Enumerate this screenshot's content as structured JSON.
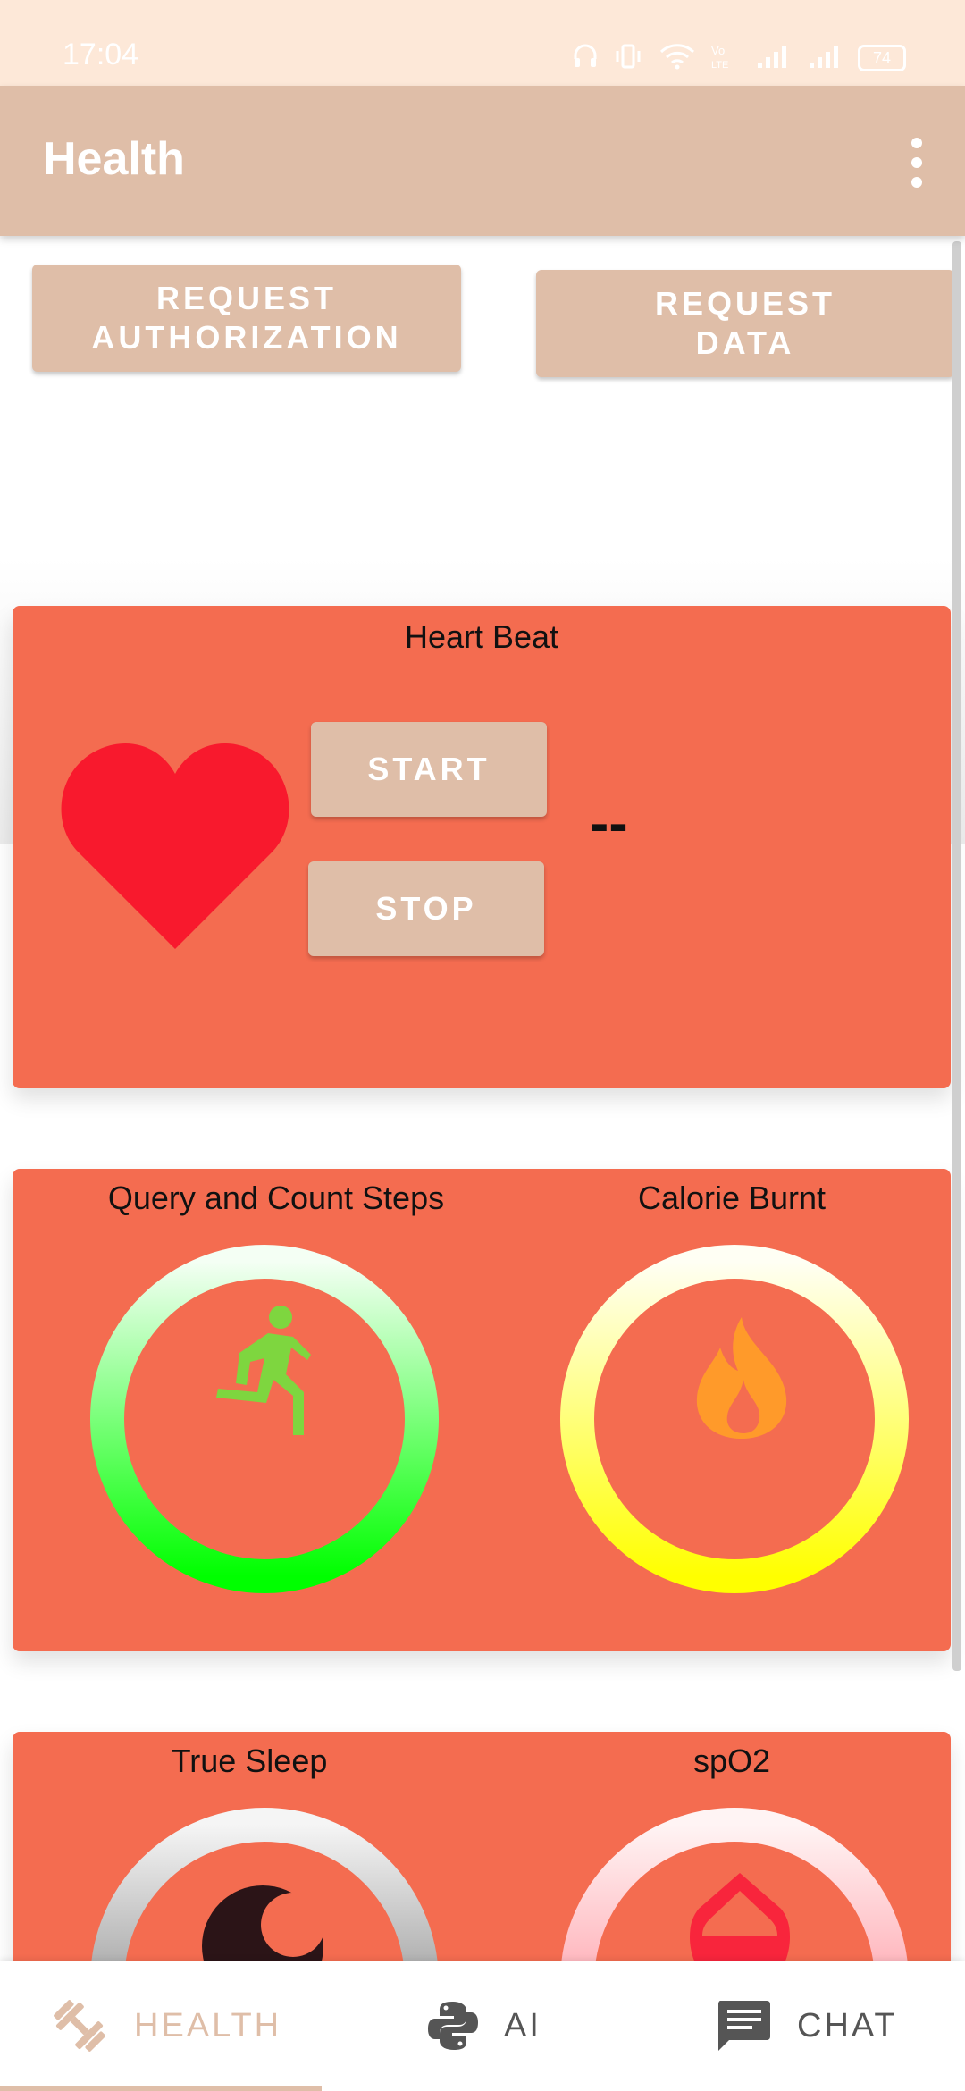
{
  "status_bar": {
    "time": "17:04",
    "battery": "74"
  },
  "app_bar": {
    "title": "Health"
  },
  "actions": {
    "request_authorization": "REQUEST\nAUTHORIZATION",
    "request_data": "REQUEST\nDATA"
  },
  "heart_card": {
    "title": "Heart Beat",
    "start_label": "START",
    "stop_label": "STOP",
    "bpm_value": "--"
  },
  "steps_card": {
    "steps_title": "Query and Count Steps",
    "calorie_title": "Calorie Burnt"
  },
  "sleep_card": {
    "sleep_title": "True Sleep",
    "spo2_title": "spO2"
  },
  "bottom_nav": {
    "items": [
      {
        "label": "HEALTH",
        "icon": "dumbbell-icon",
        "active": true
      },
      {
        "label": "AI",
        "icon": "python-icon",
        "active": false
      },
      {
        "label": "CHAT",
        "icon": "chat-icon",
        "active": false
      }
    ]
  },
  "colors": {
    "accent": "#dfbea8",
    "card": "#f46c50",
    "heart": "#f8192d",
    "steps_ring": "#00ff00",
    "calorie_ring": "#ffff00"
  }
}
